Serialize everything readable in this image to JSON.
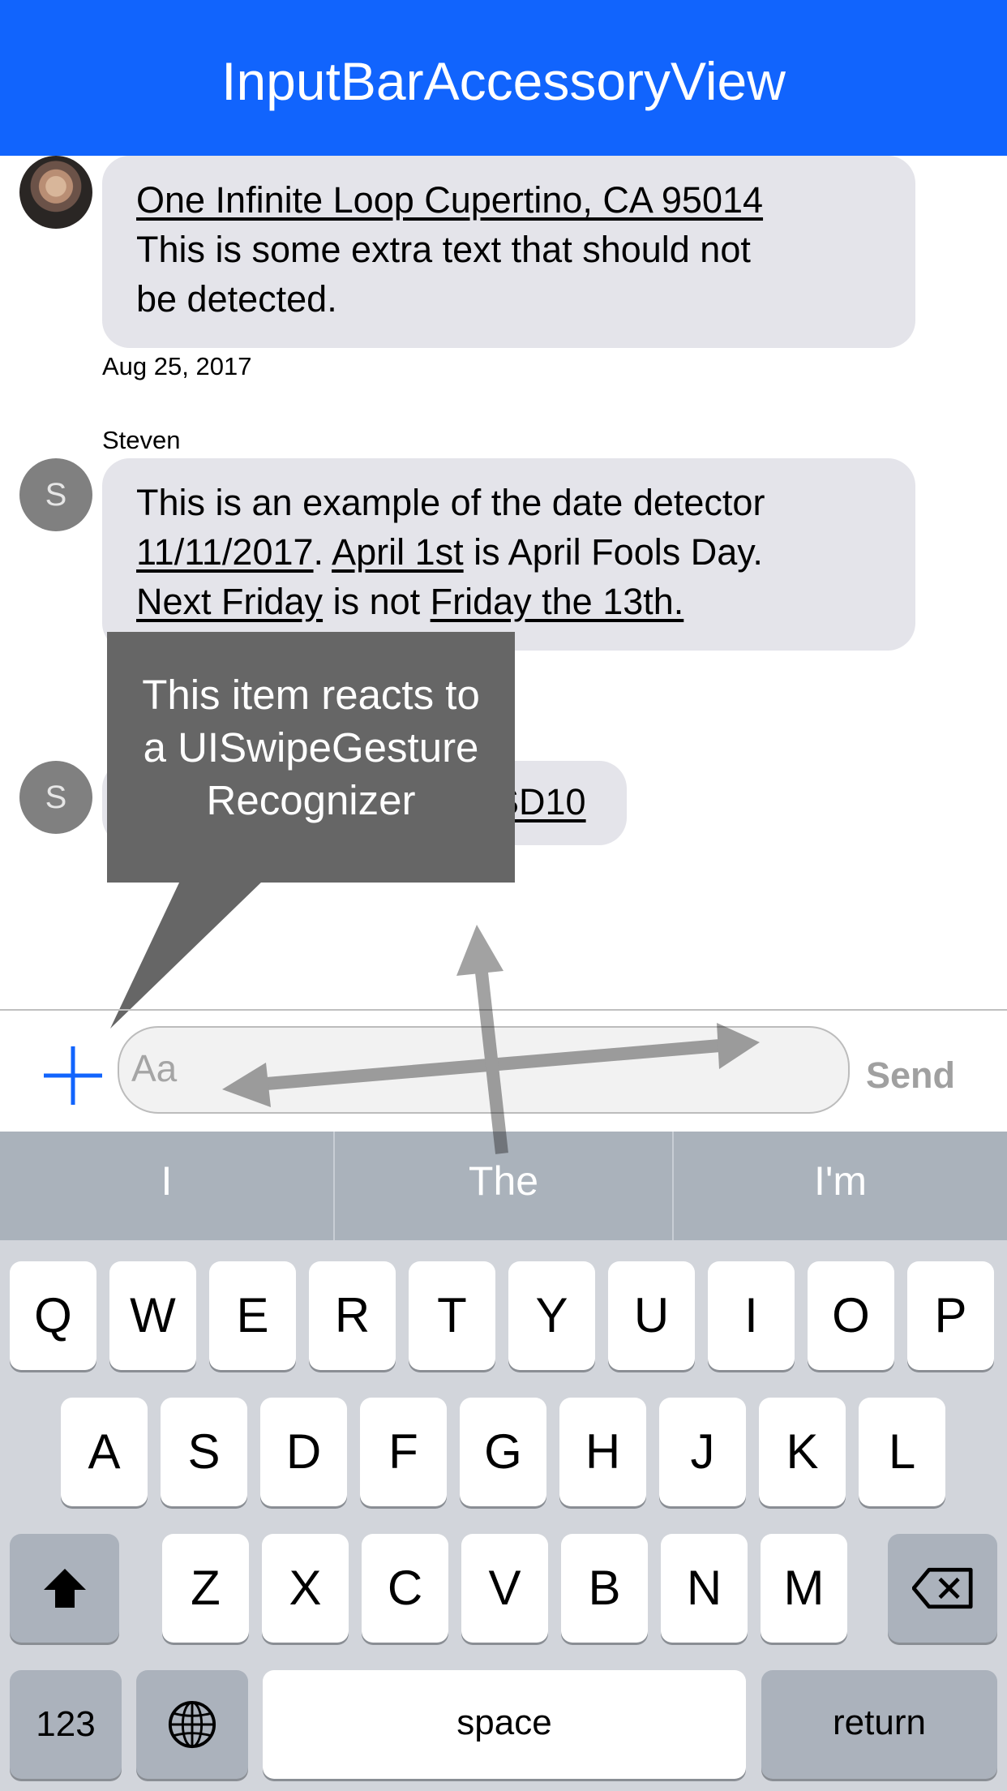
{
  "nav": {
    "title": "InputBarAccessoryView"
  },
  "messages": [
    {
      "bubble_lines": [
        [
          {
            "t": "One Infinite Loop Cupertino, CA 95014",
            "u": true
          }
        ],
        [
          {
            "t": "This is some extra text that should not",
            "u": false
          }
        ],
        [
          {
            "t": "be detected.",
            "u": false
          }
        ]
      ],
      "date": "Aug 25, 2017"
    },
    {
      "sender": "Steven",
      "avatar_initial": "S",
      "bubble_lines": [
        [
          {
            "t": "This is an example of the date detector",
            "u": false
          }
        ],
        [
          {
            "t": "11/11/2017",
            "u": true
          },
          {
            "t": ". ",
            "u": false
          },
          {
            "t": "April 1st",
            "u": true
          },
          {
            "t": " is April Fools Day.",
            "u": false
          }
        ],
        [
          {
            "t": "Next Friday",
            "u": true
          },
          {
            "t": " is not ",
            "u": false
          },
          {
            "t": "Friday the 13th.",
            "u": true
          }
        ]
      ]
    },
    {
      "avatar_initial": "S",
      "visible_fragment": "SD10"
    }
  ],
  "tooltip": {
    "lines": [
      "This item reacts to",
      "a UISwipeGesture",
      "Recognizer"
    ]
  },
  "input_bar": {
    "placeholder": "Aa",
    "send_label": "Send",
    "left_button_icon": "plus-icon"
  },
  "keyboard": {
    "suggestions": [
      "I",
      "The",
      "I'm"
    ],
    "row1": [
      "Q",
      "W",
      "E",
      "R",
      "T",
      "Y",
      "U",
      "I",
      "O",
      "P"
    ],
    "row2": [
      "A",
      "S",
      "D",
      "F",
      "G",
      "H",
      "J",
      "K",
      "L"
    ],
    "row3": [
      "Z",
      "X",
      "C",
      "V",
      "B",
      "N",
      "M"
    ],
    "shift_icon": "shift-icon",
    "delete_icon": "delete-icon",
    "numbers_label": "123",
    "globe_icon": "globe-icon",
    "space_label": "space",
    "return_label": "return"
  },
  "colors": {
    "nav_background": "#1164fd",
    "bubble_background": "#e4e4ea",
    "tooltip_background": "#666666",
    "accent": "#1164fd"
  }
}
